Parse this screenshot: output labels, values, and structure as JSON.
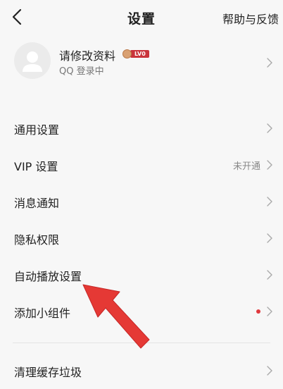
{
  "header": {
    "back_icon": "chevron-left-icon",
    "title": "设置",
    "help_label": "帮助与反馈"
  },
  "profile": {
    "name": "请修改资料",
    "level_badge": "LV0",
    "login_status": "QQ 登录中"
  },
  "menu": {
    "general": {
      "label": "通用设置"
    },
    "vip": {
      "label": "VIP 设置",
      "value": "未开通"
    },
    "notifications": {
      "label": "消息通知"
    },
    "privacy": {
      "label": "隐私权限"
    },
    "autoplay": {
      "label": "自动播放设置"
    },
    "widget": {
      "label": "添加小组件"
    },
    "cache": {
      "label": "清理缓存垃圾"
    }
  },
  "colors": {
    "background": "#f7f7f7",
    "badge_red": "#c9343b",
    "dot_red": "#e0393e",
    "arrow_red": "#e53935"
  }
}
